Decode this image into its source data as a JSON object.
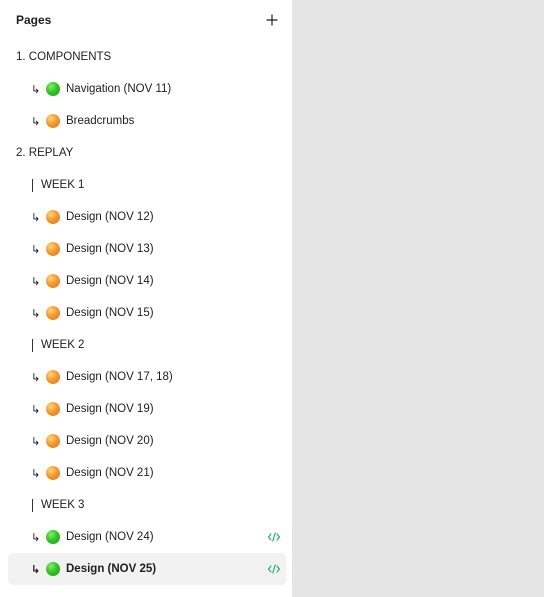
{
  "header": {
    "title": "Pages",
    "add_icon": "plus-icon"
  },
  "colors": {
    "green_status": "#33c52a",
    "orange_status": "#f59a2c",
    "dev_mode": "#14ae5c",
    "selected_bg": "#f2f2f2",
    "canvas_bg": "#e5e5e5"
  },
  "pages": [
    {
      "kind": "section",
      "label": "1. COMPONENTS"
    },
    {
      "kind": "page",
      "arrow": "↳",
      "status": "green",
      "label": "Navigation (NOV 11)"
    },
    {
      "kind": "page",
      "arrow": "↳",
      "status": "orange",
      "label": "Breadcrumbs"
    },
    {
      "kind": "section",
      "label": "2. REPLAY"
    },
    {
      "kind": "group",
      "label": "WEEK 1"
    },
    {
      "kind": "page",
      "arrow": "↳",
      "status": "orange",
      "label": "Design (NOV 12)"
    },
    {
      "kind": "page",
      "arrow": "↳",
      "status": "orange",
      "label": "Design (NOV 13)"
    },
    {
      "kind": "page",
      "arrow": "↳",
      "status": "orange",
      "label": "Design (NOV 14)"
    },
    {
      "kind": "page",
      "arrow": "↳",
      "status": "orange",
      "label": "Design (NOV 15)"
    },
    {
      "kind": "group",
      "label": "WEEK 2"
    },
    {
      "kind": "page",
      "arrow": "↳",
      "status": "orange",
      "label": "Design (NOV 17, 18)"
    },
    {
      "kind": "page",
      "arrow": "↳",
      "status": "orange",
      "label": "Design (NOV 19)"
    },
    {
      "kind": "page",
      "arrow": "↳",
      "status": "orange",
      "label": "Design (NOV 20)"
    },
    {
      "kind": "page",
      "arrow": "↳",
      "status": "orange",
      "label": "Design (NOV 21)"
    },
    {
      "kind": "group",
      "label": "WEEK 3"
    },
    {
      "kind": "page",
      "arrow": "↳",
      "status": "green",
      "label": "Design (NOV 24)",
      "dev_icon": "code-icon"
    },
    {
      "kind": "page",
      "arrow": "↳",
      "status": "green",
      "label": "Design (NOV 25)",
      "dev_icon": "code-icon",
      "selected": true
    }
  ]
}
